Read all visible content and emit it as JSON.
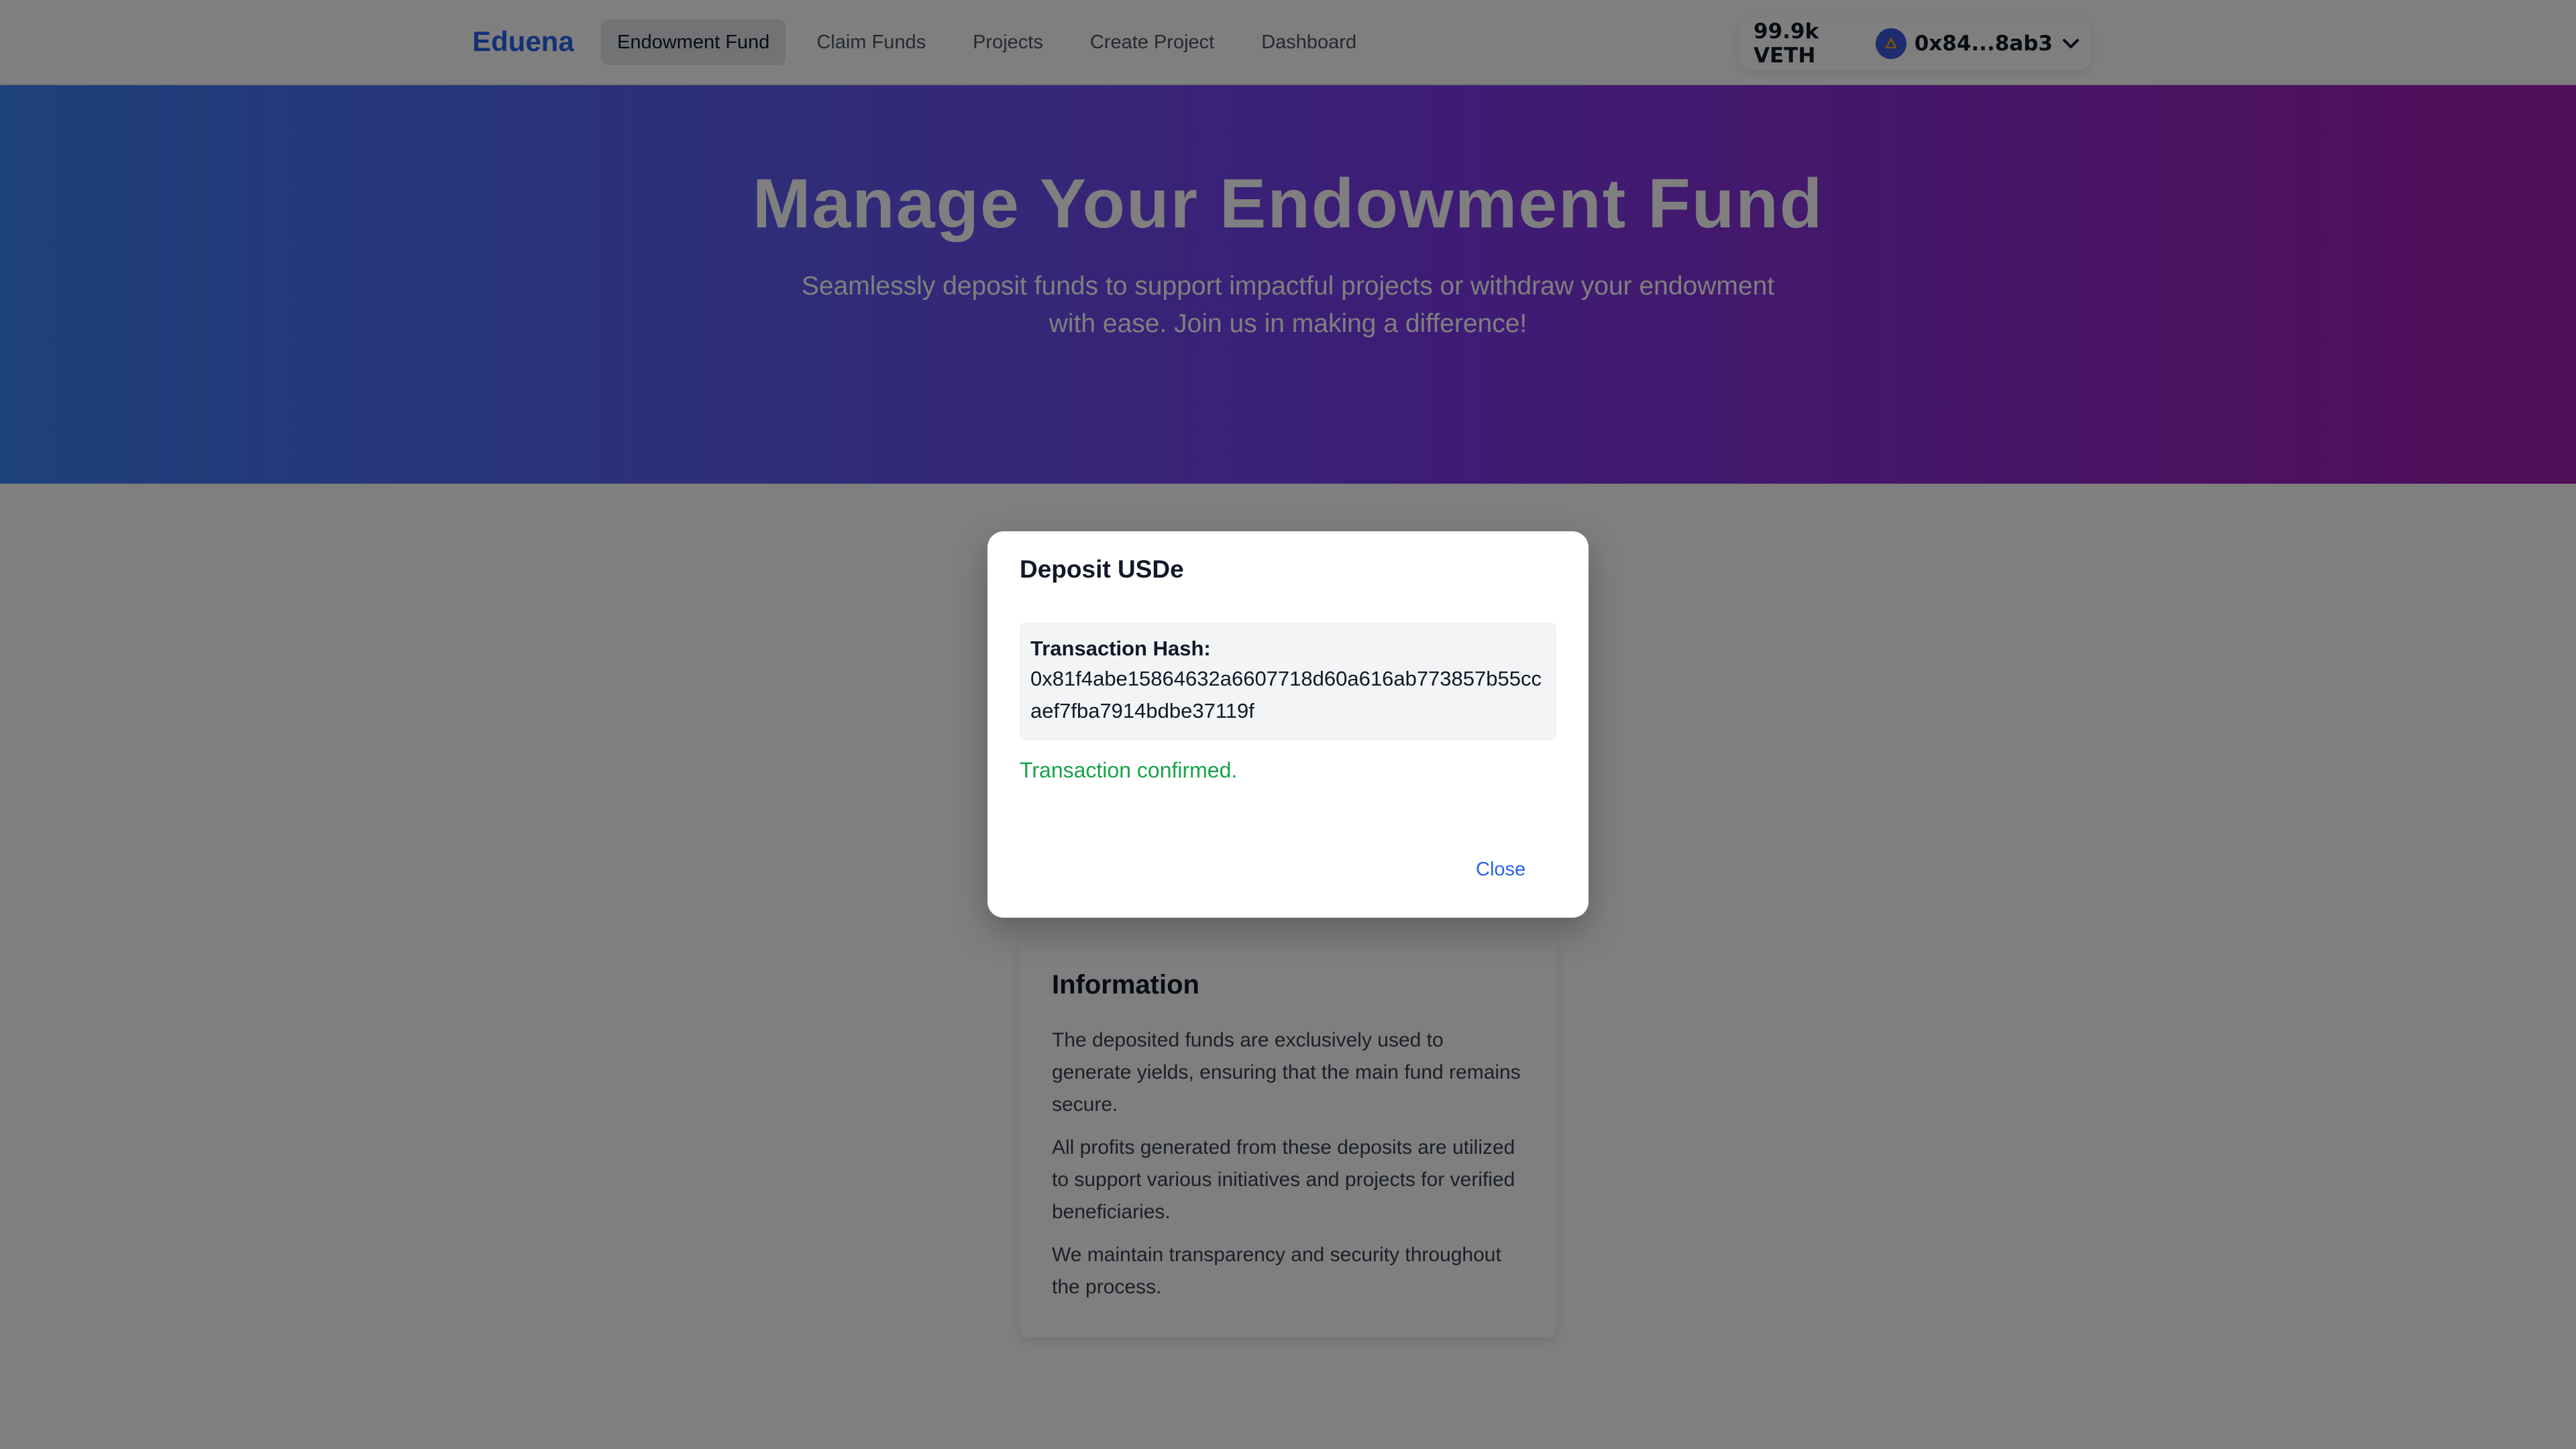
{
  "nav": {
    "brand": "Eduena",
    "links": [
      "Endowment Fund",
      "Claim Funds",
      "Projects",
      "Create Project",
      "Dashboard"
    ],
    "active_index": 0
  },
  "wallet": {
    "balance": "99.9k VETH",
    "address": "0x84...8ab3"
  },
  "hero": {
    "title": "Manage Your Endowment Fund",
    "subtitle": "Seamlessly deposit funds to support impactful projects or withdraw your endowment with ease. Join us in making a difference!"
  },
  "info": {
    "title": "Information",
    "paragraphs": [
      "The deposited funds are exclusively used to generate yields, ensuring that the main fund remains secure.",
      "All profits generated from these deposits are utilized to support various initiatives and projects for verified beneficiaries.",
      "We maintain transparency and security throughout the process."
    ]
  },
  "modal": {
    "title": "Deposit USDe",
    "hash_label": "Transaction Hash:",
    "hash_value": "0x81f4abe15864632a6607718d60a616ab773857b55ccaef7fba7914bdbe37119f",
    "status": "Transaction confirmed.",
    "close_label": "Close"
  },
  "colors": {
    "brand": "#2563eb",
    "success": "#16a34a",
    "hero_gradient_start": "#3b82f6",
    "hero_gradient_end": "#a21caf"
  },
  "icons": [
    "chain-icon",
    "chevron-down-icon"
  ]
}
